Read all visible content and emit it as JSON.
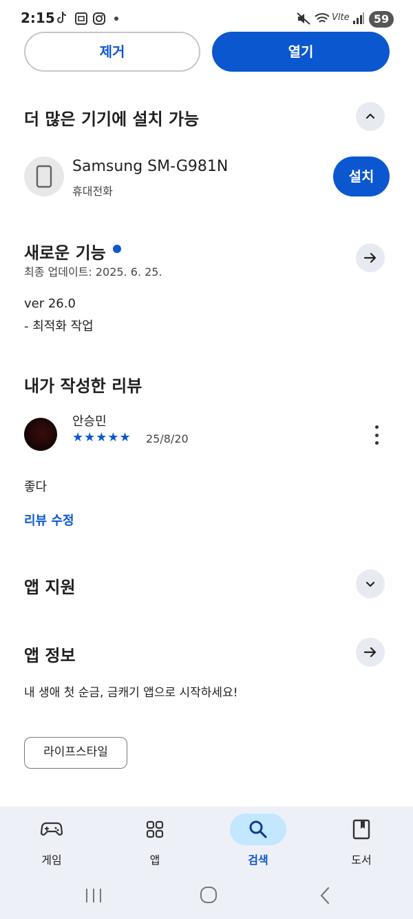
{
  "status_bar": {
    "time": "2:15",
    "battery": "59"
  },
  "top_actions": {
    "remove_label": "제거",
    "open_label": "열기"
  },
  "more_devices": {
    "title": "더 많은 기기에 설치 가능",
    "device_name": "Samsung SM-G981N",
    "device_type": "휴대전화",
    "install_label": "설치"
  },
  "whats_new": {
    "title": "새로운 기능",
    "updated": "최종 업데이트: 2025. 6. 25.",
    "version": "ver 26.0",
    "notes": "- 최적화 작업"
  },
  "my_review": {
    "title": "내가 작성한 리뷰",
    "reviewer": "안승민",
    "rating": 5,
    "stars": "★★★★★",
    "date": "25/8/20",
    "text": "좋다",
    "edit_label": "리뷰 수정"
  },
  "app_support": {
    "title": "앱 지원"
  },
  "app_info": {
    "title": "앱 정보",
    "description": "내 생애 첫 순금, 금캐기 앱으로 시작하세요!",
    "tag": "라이프스타일"
  },
  "bottom_nav": {
    "items": [
      {
        "label": "게임",
        "icon": "gamepad-icon",
        "active": false
      },
      {
        "label": "앱",
        "icon": "apps-grid-icon",
        "active": false
      },
      {
        "label": "검색",
        "icon": "search-icon",
        "active": true
      },
      {
        "label": "도서",
        "icon": "book-icon",
        "active": false
      }
    ]
  },
  "colors": {
    "accent": "#0b57d0",
    "nav_bg": "#eef0f7",
    "nav_active": "#c2e7ff"
  }
}
